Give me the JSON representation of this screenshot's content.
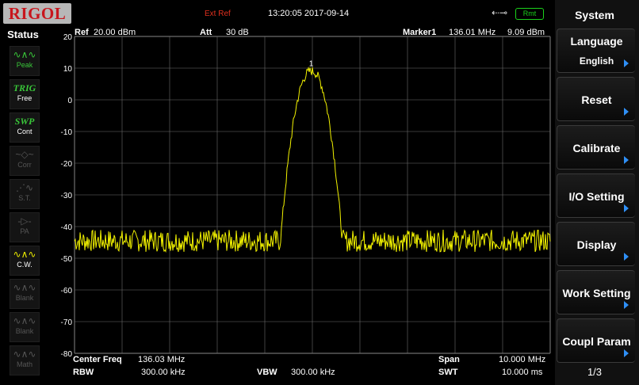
{
  "header": {
    "logo": "RIGOL",
    "ext_ref": "Ext Ref",
    "datetime": "13:20:05 2017-09-14",
    "usb_icon": "usb-icon",
    "remote": "Rmt"
  },
  "status_panel": {
    "title": "Status",
    "items": [
      {
        "icon": "peak-icon",
        "label": "Peak"
      },
      {
        "icon": "TRIG",
        "label": "Free"
      },
      {
        "icon": "SWP",
        "label": "Cont"
      },
      {
        "icon": "corr-icon",
        "label": "Corr"
      },
      {
        "icon": "st-icon",
        "label": "S.T."
      },
      {
        "icon": "pa-icon",
        "label": "PA"
      },
      {
        "icon": "cw-icon",
        "label": "C.W."
      },
      {
        "icon": "blank-icon",
        "label": "Blank"
      },
      {
        "icon": "blank-icon",
        "label": "Blank"
      },
      {
        "icon": "math-icon",
        "label": "Math"
      }
    ]
  },
  "measurement": {
    "ref_label": "Ref",
    "ref_value": "20.00 dBm",
    "att_label": "Att",
    "att_value": "30 dB",
    "marker_label": "Marker1",
    "marker_freq": "136.01 MHz",
    "marker_level": "9.09 dBm",
    "center_label": "Center Freq",
    "center_value": "136.03 MHz",
    "span_label": "Span",
    "span_value": "10.000 MHz",
    "rbw_label": "RBW",
    "rbw_value": "300.00 kHz",
    "vbw_label": "VBW",
    "vbw_value": "300.00 kHz",
    "swt_label": "SWT",
    "swt_value": "10.000 ms",
    "marker_tag": "1"
  },
  "chart_data": {
    "type": "line",
    "y_ticks": [
      "20",
      "10",
      "0",
      "-10",
      "-20",
      "-30",
      "-40",
      "-50",
      "-60",
      "-70",
      "-80"
    ],
    "ylim": [
      -80,
      20
    ],
    "xlim_mhz": [
      131.03,
      141.03
    ],
    "grid": true,
    "trace_color": "#f2f200",
    "series": [
      {
        "noise_floor_dbm": -44.5,
        "signal_center_mhz": 136.01,
        "signal_peak_dbm": 9.09,
        "signal_width_mhz": 1.3
      }
    ]
  },
  "menu": {
    "title": "System",
    "buttons": [
      {
        "label": "Language",
        "sub": "English"
      },
      {
        "label": "Reset"
      },
      {
        "label": "Calibrate"
      },
      {
        "label": "I/O Setting"
      },
      {
        "label": "Display"
      },
      {
        "label": "Work Setting"
      },
      {
        "label": "Coupl Param"
      }
    ],
    "page": "1/3"
  },
  "colors": {
    "trace": "#f2f200",
    "grid": "#6e6e6e",
    "status_active": "#39c639",
    "ext_ref": "#e0301e",
    "arrow": "#2f8ff5"
  }
}
